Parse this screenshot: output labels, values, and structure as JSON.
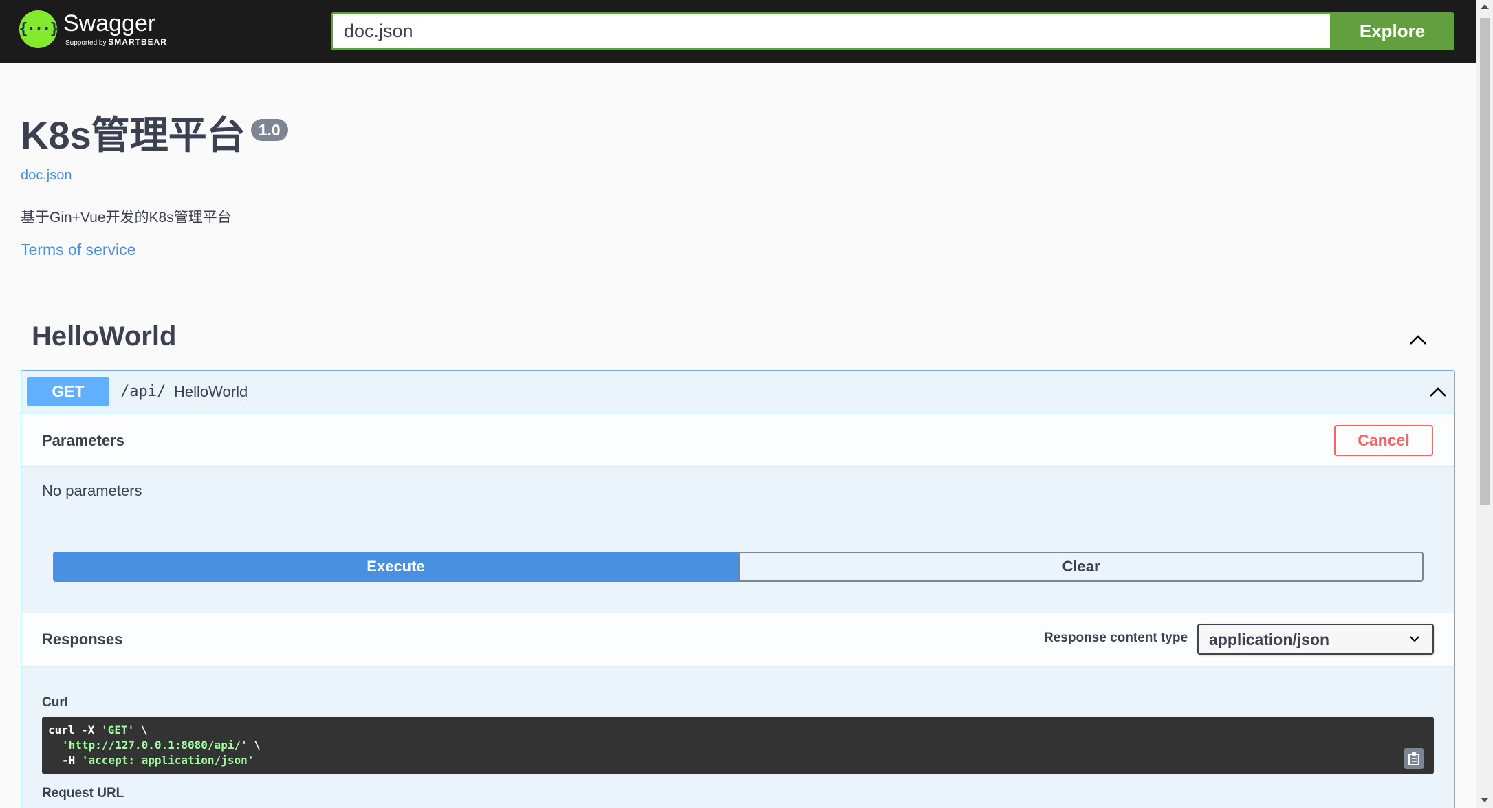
{
  "topbar": {
    "logo_title": "Swagger",
    "logo_supported": "Supported by",
    "logo_brand": "SMARTBEAR",
    "url_value": "doc.json",
    "explore_label": "Explore",
    "brand_color": "#85ea2d",
    "accent_color": "#62a03f"
  },
  "info": {
    "title": "K8s管理平台",
    "version": "1.0",
    "doc_link": "doc.json",
    "description": "基于Gin+Vue开发的K8s管理平台",
    "tos_label": "Terms of service"
  },
  "tag": {
    "name": "HelloWorld"
  },
  "operation": {
    "method": "GET",
    "path": "/api/",
    "summary": "HelloWorld",
    "method_color": "#61affe",
    "parameters_title": "Parameters",
    "cancel_label": "Cancel",
    "no_parameters": "No parameters",
    "execute_label": "Execute",
    "clear_label": "Clear",
    "responses_title": "Responses",
    "content_type_label": "Response content type",
    "content_type_value": "application/json",
    "curl_label": "Curl",
    "curl": {
      "l1_cmd": "curl -X ",
      "l1_str": "'GET'",
      "l1_tail": " \\",
      "l2_str": "'http://127.0.0.1:8080/api/'",
      "l2_tail": " \\",
      "l3_cmd": "-H ",
      "l3_str": "'accept: application/json'"
    },
    "request_url_label": "Request URL"
  },
  "icons": [
    "swagger-logo-icon",
    "chevron-up-icon",
    "chevron-down-icon",
    "copy-clipboard-icon"
  ]
}
